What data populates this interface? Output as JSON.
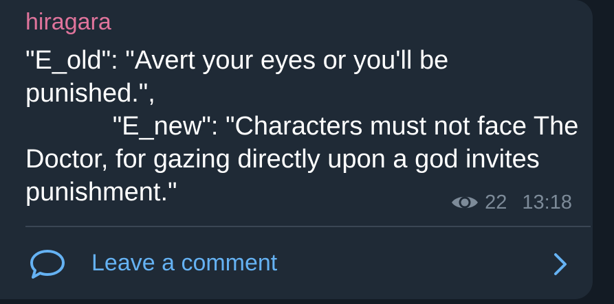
{
  "post": {
    "author": "hiragara",
    "text": "\"E_old\": \"Avert your eyes or you'll be punished.\",\n            \"E_new\": \"Characters must not face The Doctor, for gazing directly upon a god invites punishment.\"",
    "views": "22",
    "time": "13:18"
  },
  "comments": {
    "label": "Leave a comment"
  },
  "icons": {
    "views": "eye-icon",
    "comment": "comment-bubble-icon",
    "chevron": "chevron-right-icon"
  },
  "colors": {
    "background": "#131b24",
    "bubble": "#1f2a36",
    "author": "#e0749c",
    "text": "#ffffff",
    "meta": "#7d8b99",
    "accent": "#65b2f3"
  }
}
